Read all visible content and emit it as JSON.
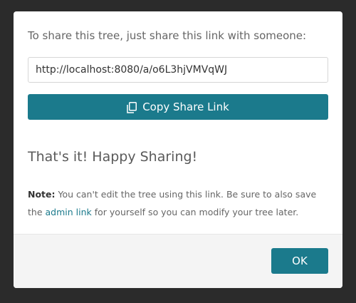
{
  "dialog": {
    "intro_text": "To share this tree, just share this link with someone:",
    "share_link_value": "http://localhost:8080/a/o6L3hjVMVqWJ",
    "copy_button_label": "Copy Share Link",
    "copy_icon": "copy-icon",
    "headline": "That's it! Happy Sharing!",
    "note": {
      "label": "Note:",
      "text_before_link": "You can't edit the tree using this link. Be sure to also save the",
      "link_text": "admin link",
      "text_after_link": "for yourself so you can modify your tree later."
    },
    "ok_button_label": "OK"
  },
  "colors": {
    "accent": "#1b7a8c",
    "backdrop": "#2b2b2b",
    "footer_bg": "#f4f4f4"
  }
}
